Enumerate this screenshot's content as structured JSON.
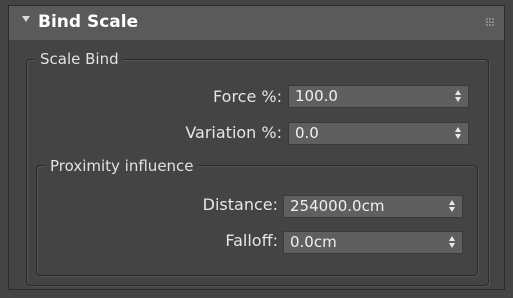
{
  "rollout": {
    "title": "Bind Scale",
    "collapse_icon": "triangle-down",
    "grip_icon": "drag-grip"
  },
  "scale_bind": {
    "group_label": "Scale Bind",
    "force": {
      "label": "Force %:",
      "value": "100.0"
    },
    "variation": {
      "label": "Variation %:",
      "value": "0.0"
    }
  },
  "proximity": {
    "group_label": "Proximity influence",
    "distance": {
      "label": "Distance:",
      "value": "254000.0cm"
    },
    "falloff": {
      "label": "Falloff:",
      "value": "0.0cm"
    }
  },
  "colors": {
    "panel_bg": "#444444",
    "header_bg": "#5a5a5a",
    "field_bg": "#5f5f5f",
    "text": "#e6e6e6"
  }
}
